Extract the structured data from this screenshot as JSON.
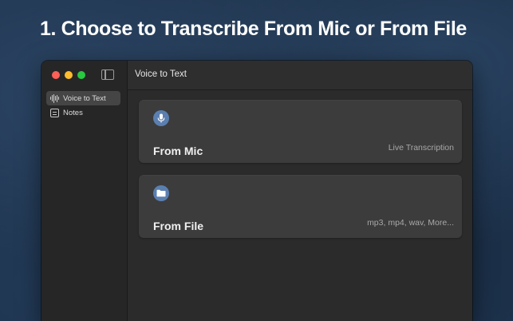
{
  "headline": "1. Choose to Transcribe From Mic or From File",
  "window": {
    "title": "Voice to Text",
    "traffic_lights": {
      "close": "#fe5f57",
      "minimize": "#febc2e",
      "maximize": "#28c840"
    }
  },
  "sidebar": {
    "items": [
      {
        "label": "Voice to Text",
        "icon": "waveform-icon",
        "selected": true
      },
      {
        "label": "Notes",
        "icon": "notes-icon",
        "selected": false
      }
    ]
  },
  "cards": [
    {
      "title": "From Mic",
      "subtitle": "Live Transcription",
      "icon": "microphone-icon"
    },
    {
      "title": "From File",
      "subtitle": "mp3, mp4, wav, More...",
      "icon": "folder-icon"
    }
  ],
  "colors": {
    "accent": "#5a7fb0",
    "card": "#3c3c3c",
    "background": "#1f3550"
  }
}
